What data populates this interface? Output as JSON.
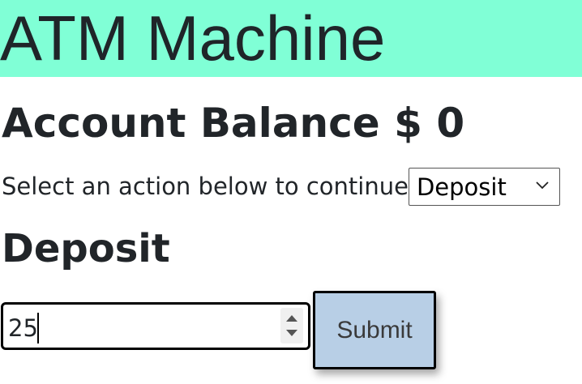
{
  "header": {
    "title": "ATM Machine",
    "background": "#80ffd6"
  },
  "balance": {
    "label": "Account Balance",
    "currency": "$",
    "amount": "0"
  },
  "action": {
    "prompt": "Select an action below to continue",
    "selected": "Deposit",
    "icon": "chevron-down-icon"
  },
  "form": {
    "heading": "Deposit",
    "amount_value": "25",
    "submit_label": "Submit",
    "submit_color": "#b8cfe6"
  }
}
